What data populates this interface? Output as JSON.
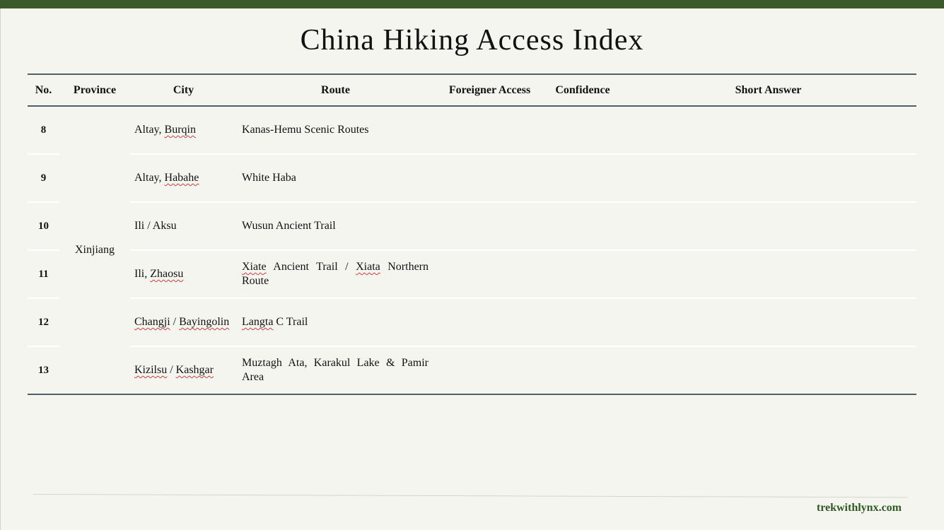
{
  "title": "China Hiking Access Index",
  "columns": [
    "No.",
    "Province",
    "City",
    "Route",
    "Foreigner Access",
    "Confidence",
    "Short Answer"
  ],
  "province": "Xinjiang",
  "rows": [
    {
      "no": "8",
      "city_a": "Altay, ",
      "city_b": "Burqin",
      "city_c": "",
      "city_d": "",
      "route_a": "Kanas-Hemu Scenic Routes",
      "route_b": "",
      "route_c": "",
      "route_d": "",
      "foreigner_access": "",
      "confidence": "",
      "short_answer": ""
    },
    {
      "no": "9",
      "city_a": "Altay, ",
      "city_b": "Habahe",
      "city_c": "",
      "city_d": "",
      "route_a": "White Haba",
      "route_b": "",
      "route_c": "",
      "route_d": "",
      "foreigner_access": "",
      "confidence": "",
      "short_answer": ""
    },
    {
      "no": "10",
      "city_a": "Ili / Aksu",
      "city_b": "",
      "city_c": "",
      "city_d": "",
      "route_a": "Wusun Ancient Trail",
      "route_b": "",
      "route_c": "",
      "route_d": "",
      "foreigner_access": "",
      "confidence": "",
      "short_answer": ""
    },
    {
      "no": "11",
      "city_a": "Ili, ",
      "city_b": "Zhaosu",
      "city_c": "",
      "city_d": "",
      "route_a": "",
      "route_b": "Xiate",
      "route_c": " Ancient Trail / ",
      "route_d": "Xiata",
      "route_e": " Northern Route",
      "foreigner_access": "",
      "confidence": "",
      "short_answer": ""
    },
    {
      "no": "12",
      "city_a": "",
      "city_b": "Changji",
      "city_c": " / ",
      "city_d": "Bayingolin",
      "route_a": "",
      "route_b": "Langta",
      "route_c": " C Trail",
      "route_d": "",
      "foreigner_access": "",
      "confidence": "",
      "short_answer": ""
    },
    {
      "no": "13",
      "city_a": "",
      "city_b": "Kizilsu",
      "city_c": " / ",
      "city_d": "Kashgar",
      "route_a": "Muztagh Ata, Karakul Lake & Pamir Area",
      "route_b": "",
      "route_c": "",
      "route_d": "",
      "foreigner_access": "",
      "confidence": "",
      "short_answer": ""
    }
  ],
  "footer": {
    "brand": "trekwithlynx.com"
  },
  "colors": {
    "top_bar": "#3b5a2c",
    "brand": "#2f5a22",
    "background": "#f5f5f0",
    "rule": "#4f5d66"
  }
}
